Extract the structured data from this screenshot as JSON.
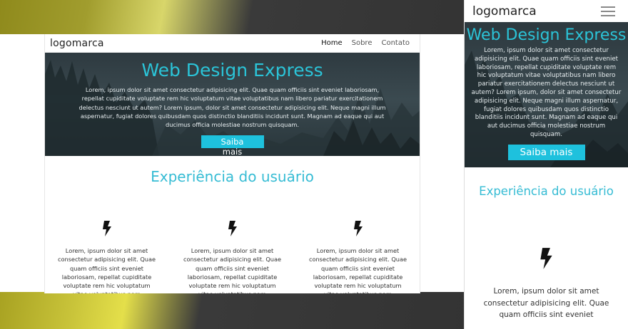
{
  "desktop": {
    "logo": "logomarca",
    "nav": [
      "Home",
      "Sobre",
      "Contato"
    ],
    "hero": {
      "title": "Web Design Express",
      "text": "Lorem, ipsum dolor sit amet consectetur adipisicing elit. Quae quam officiis sint eveniet laboriosam, repellat cupiditate voluptate rem hic voluptatum vitae voluptatibus nam libero pariatur exercitationem delectus nesciunt ut autem? Lorem ipsum, dolor sit amet consectetur adipisicing elit. Neque magni illum aspernatur, fugiat dolores quibusdam quos distinctio blanditiis incidunt sunt. Magnam ad eaque qui aut ducimus officia molestiae nostrum quisquam.",
      "button": "Saiba mais"
    },
    "section_title": "Experiência do usuário",
    "features": [
      {
        "icon": "bolt-icon",
        "text": "Lorem, ipsum dolor sit amet consectetur adipisicing elit. Quae quam officiis sint eveniet laboriosam, repellat cupiditate voluptate rem hic voluptatum vitae voluptatibus nam"
      },
      {
        "icon": "bolt-icon",
        "text": "Lorem, ipsum dolor sit amet consectetur adipisicing elit. Quae quam officiis sint eveniet laboriosam, repellat cupiditate voluptate rem hic voluptatum vitae voluptatibus nam"
      },
      {
        "icon": "bolt-icon",
        "text": "Lorem, ipsum dolor sit amet consectetur adipisicing elit. Quae quam officiis sint eveniet laboriosam, repellat cupiditate voluptate rem hic voluptatum vitae voluptatibus nam"
      }
    ]
  },
  "mobile": {
    "logo": "logomarca",
    "menu_icon": "hamburger-icon",
    "hero": {
      "title": "Web Design Express",
      "text": "Lorem, ipsum dolor sit amet consectetur adipisicing elit. Quae quam officiis sint eveniet laboriosam, repellat cupiditate voluptate rem hic voluptatum vitae voluptatibus nam libero pariatur exercitationem delectus nesciunt ut autem? Lorem ipsum, dolor sit amet consectetur adipisicing elit. Neque magni illum aspernatur, fugiat dolores quibusdam quos distinctio blanditiis incidunt sunt. Magnam ad eaque qui aut ducimus officia molestiae nostrum quisquam.",
      "button": "Saiba mais"
    },
    "section_title": "Experiência do usuário",
    "feature_text": "Lorem, ipsum dolor sit amet consectetur adipisicing elit. Quae quam officiis sint eveniet"
  },
  "colors": {
    "accent": "#1ec1dd",
    "title": "#36bcd4",
    "hero_bg": "#34434a"
  }
}
